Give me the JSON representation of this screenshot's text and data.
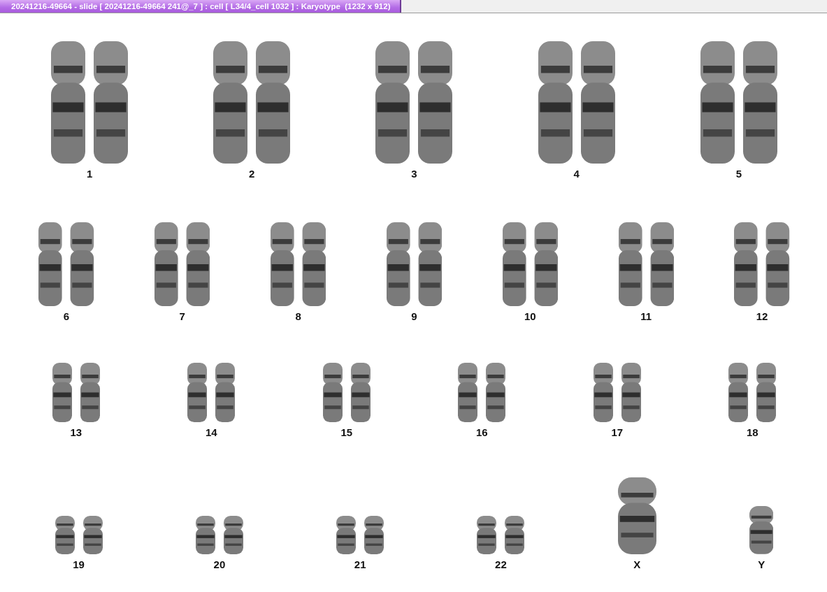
{
  "window": {
    "title": "20241216-49664 - slide [ 20241216-49664 241@_7 ] : cell [ L34/4_cell 1032 ] : Karyotype  (1232 x 912)"
  },
  "karyotype": {
    "rows": [
      {
        "groups": [
          {
            "label": "1",
            "kind": "pair"
          },
          {
            "label": "2",
            "kind": "pair"
          },
          {
            "label": "3",
            "kind": "pair"
          },
          {
            "label": "4",
            "kind": "pair"
          },
          {
            "label": "5",
            "kind": "pair"
          }
        ]
      },
      {
        "groups": [
          {
            "label": "6",
            "kind": "pair"
          },
          {
            "label": "7",
            "kind": "pair"
          },
          {
            "label": "8",
            "kind": "pair"
          },
          {
            "label": "9",
            "kind": "pair"
          },
          {
            "label": "10",
            "kind": "pair"
          },
          {
            "label": "11",
            "kind": "pair"
          },
          {
            "label": "12",
            "kind": "pair"
          }
        ]
      },
      {
        "groups": [
          {
            "label": "13",
            "kind": "pair"
          },
          {
            "label": "14",
            "kind": "pair"
          },
          {
            "label": "15",
            "kind": "pair"
          },
          {
            "label": "16",
            "kind": "pair"
          },
          {
            "label": "17",
            "kind": "pair"
          },
          {
            "label": "18",
            "kind": "pair"
          }
        ]
      },
      {
        "groups": [
          {
            "label": "19",
            "kind": "pair"
          },
          {
            "label": "20",
            "kind": "pair"
          },
          {
            "label": "21",
            "kind": "pair"
          },
          {
            "label": "22",
            "kind": "pair"
          },
          {
            "label": "X",
            "kind": "single"
          },
          {
            "label": "Y",
            "kind": "single"
          }
        ]
      }
    ]
  }
}
